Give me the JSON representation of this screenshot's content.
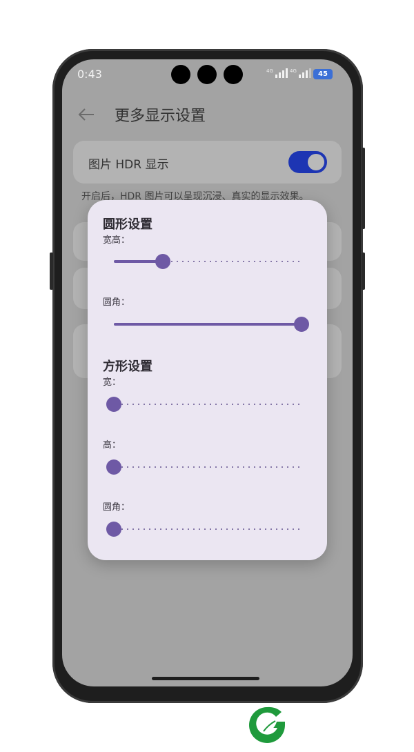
{
  "status_bar": {
    "time": "0:43",
    "sim1": "4G",
    "sim2": "4G",
    "battery": "45"
  },
  "header": {
    "title": "更多显示设置"
  },
  "background": {
    "hdr_label": "图片 HDR 显示",
    "hdr_toggle_on": true,
    "hdr_description": "开启后，HDR 图片可以呈现沉浸、真实的显示效果。"
  },
  "dialog": {
    "circle": {
      "title": "圆形设置",
      "size_label": "宽高：",
      "size_value": 0.26,
      "radius_label": "圆角：",
      "radius_value": 1.0
    },
    "square": {
      "title": "方形设置",
      "width_label": "宽：",
      "width_value": 0.0,
      "height_label": "高：",
      "height_value": 0.0,
      "radius_label": "圆角：",
      "radius_value": 0.0
    }
  },
  "colors": {
    "accent": "#6e59a5",
    "toggle": "#1d35b3",
    "dialog_bg": "#ebe6f2"
  }
}
